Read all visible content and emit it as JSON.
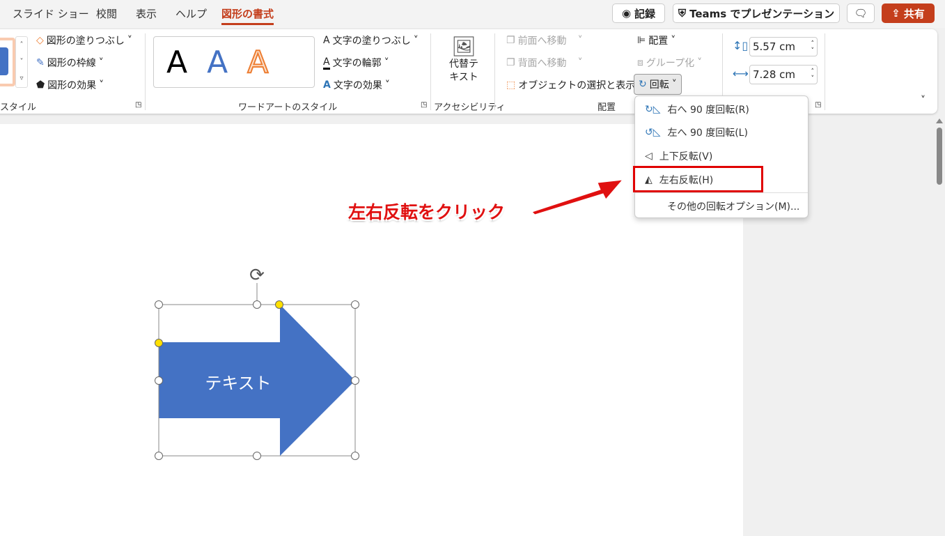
{
  "tabs": [
    "スライド ショー",
    "校閲",
    "表示",
    "ヘルプ",
    "図形の書式"
  ],
  "active_tab": "図形の書式",
  "top_buttons": {
    "record": "記録",
    "teams": "Teams でプレゼンテーション",
    "share": "共有"
  },
  "ribbon": {
    "shape_styles": {
      "fill": "図形の塗りつぶし",
      "outline": "図形の枠線",
      "effects": "図形の効果",
      "group_label": "スタイル"
    },
    "wordart": {
      "samples": [
        "A",
        "A",
        "A"
      ],
      "text_fill": "文字の塗りつぶし",
      "text_outline": "文字の輪郭",
      "text_effects": "文字の効果",
      "group_label": "ワードアートのスタイル"
    },
    "accessibility": {
      "alt_text": "代替テ\nキスト",
      "group_label": "アクセシビリティ"
    },
    "arrange": {
      "bring_forward": "前面へ移動",
      "send_backward": "背面へ移動",
      "selection_pane": "オブジェクトの選択と表示",
      "align": "配置",
      "group": "グループ化",
      "rotate": "回転",
      "group_label": "配置"
    },
    "size": {
      "height": "5.57 cm",
      "width": "7.28 cm"
    }
  },
  "rotate_menu": {
    "items": [
      "右へ 90 度回転(R)",
      "左へ 90 度回転(L)",
      "上下反転(V)",
      "左右反転(H)"
    ],
    "more": "その他の回転オプション(M)..."
  },
  "shape": {
    "text": "テキスト",
    "fill": "#4472c4"
  },
  "annotation": {
    "text": "左右反転をクリック",
    "color": "#e01010"
  }
}
